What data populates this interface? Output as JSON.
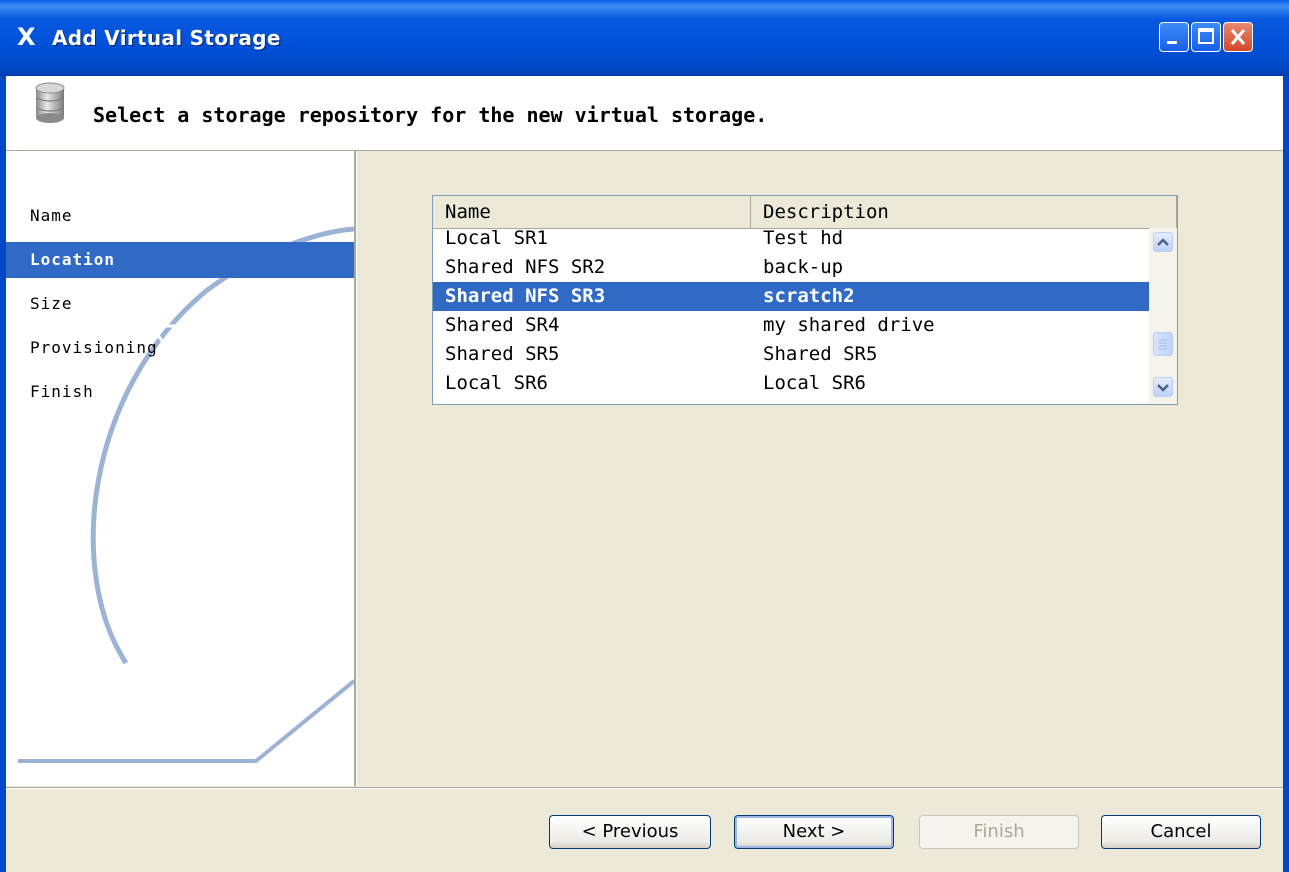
{
  "window": {
    "title": "Add Virtual Storage",
    "app_icon": "X"
  },
  "header": {
    "instruction": "Select a storage repository for the new virtual storage.",
    "icon": "storage-icon"
  },
  "sidebar": {
    "steps": [
      {
        "label": "Name",
        "active": false
      },
      {
        "label": "Location",
        "active": true
      },
      {
        "label": "Size",
        "active": false
      },
      {
        "label": "Provisioning",
        "active": false
      },
      {
        "label": "Finish",
        "active": false
      }
    ]
  },
  "table": {
    "columns": [
      "Name",
      "Description"
    ],
    "rows": [
      {
        "name": "Local SR1",
        "description": "Test hd",
        "selected": false
      },
      {
        "name": "Shared NFS SR2",
        "description": "back-up",
        "selected": false
      },
      {
        "name": "Shared NFS SR3",
        "description": "scratch2",
        "selected": true
      },
      {
        "name": "Shared SR4",
        "description": "my shared drive",
        "selected": false
      },
      {
        "name": "Shared SR5",
        "description": "Shared SR5",
        "selected": false
      },
      {
        "name": "Local SR6",
        "description": "Local SR6",
        "selected": false
      }
    ]
  },
  "buttons": {
    "previous": "< Previous",
    "next": "Next >",
    "finish": "Finish",
    "cancel": "Cancel"
  },
  "colors": {
    "selection": "#316AC5",
    "titlebar": "#0050D8",
    "dialog_bg": "#ECE9D8"
  }
}
